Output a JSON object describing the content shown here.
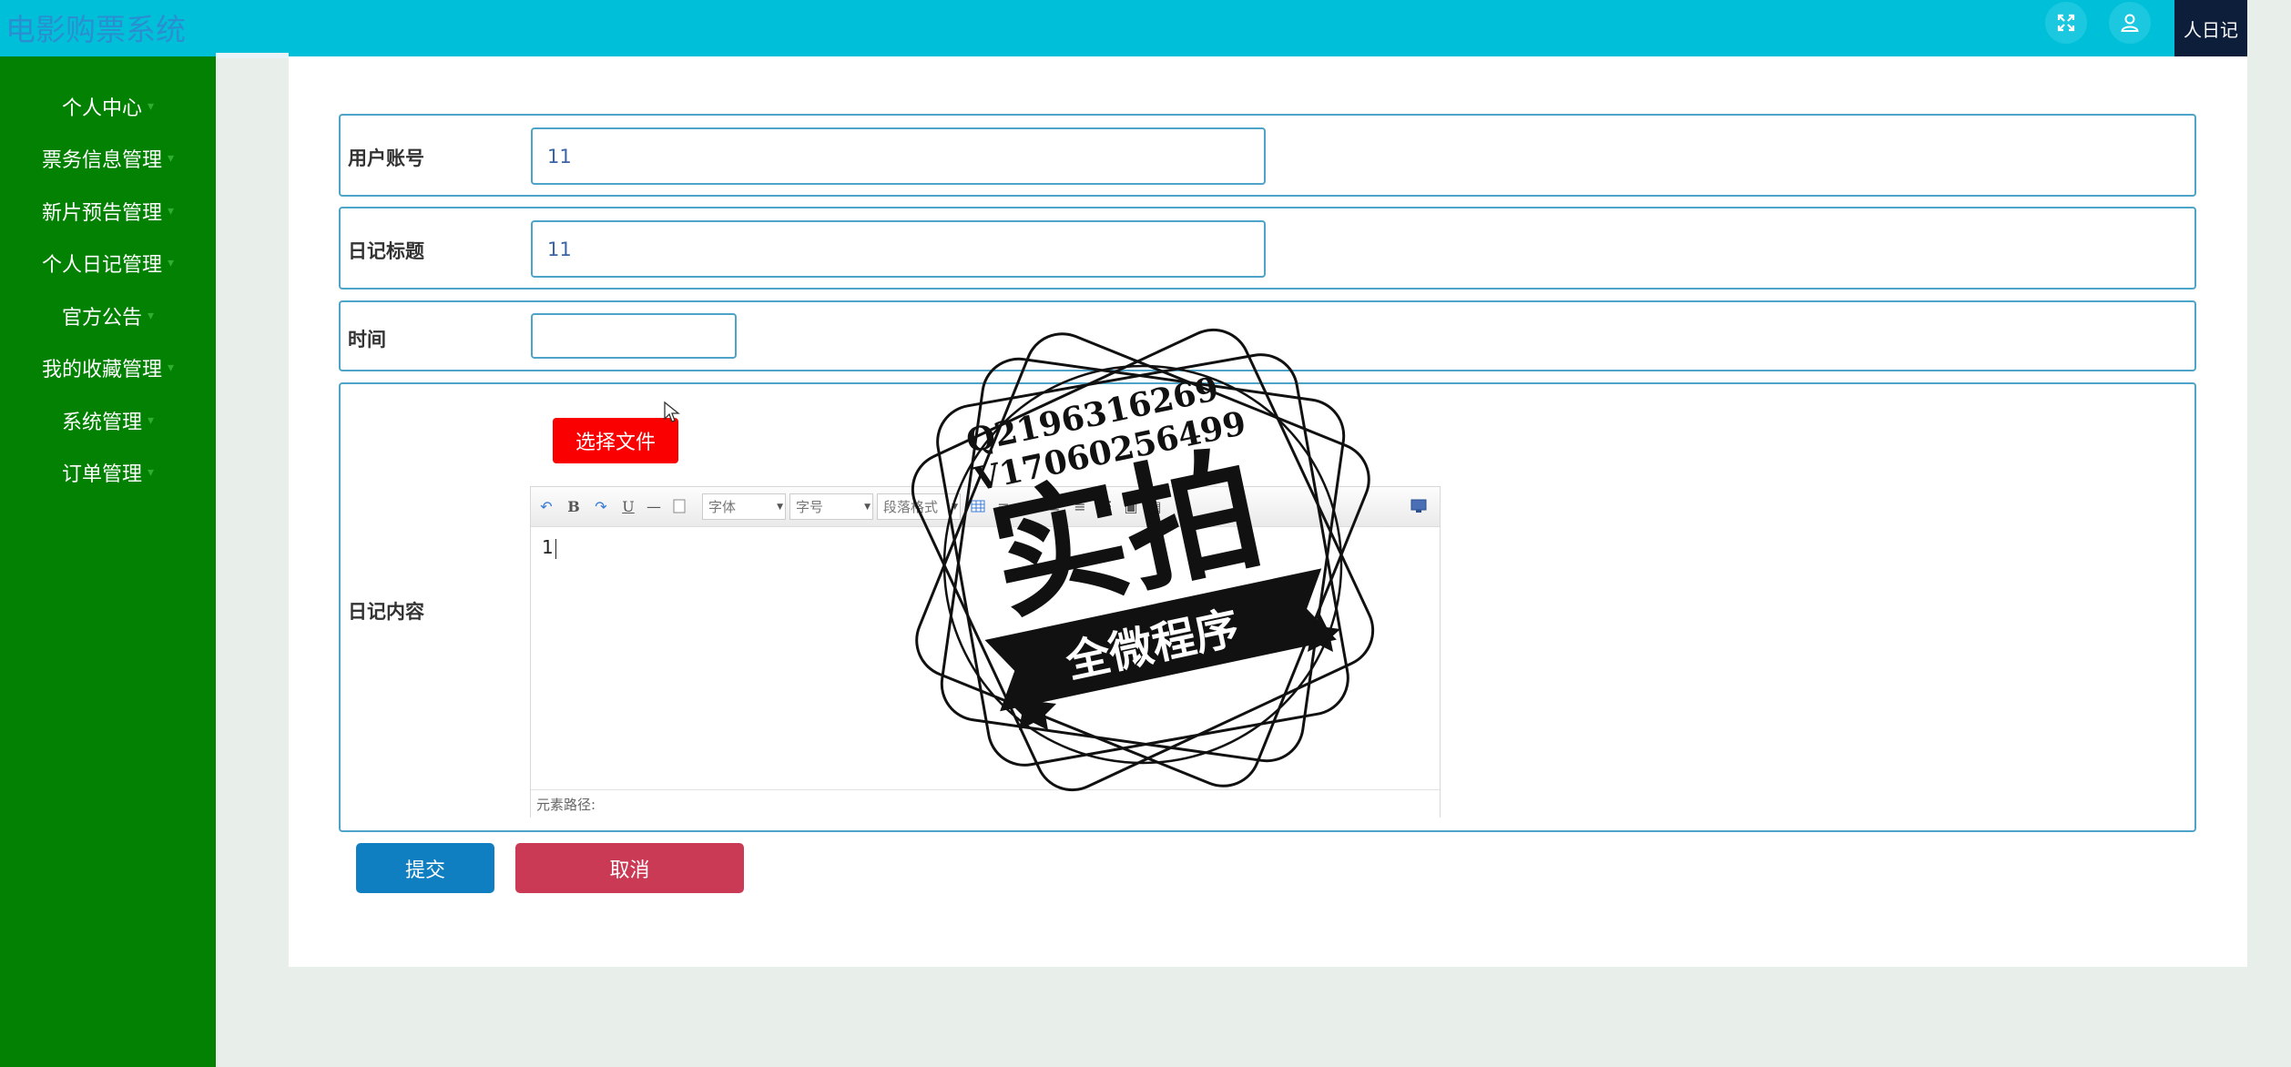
{
  "app": {
    "title": "电影购票系统"
  },
  "header": {
    "icons": [
      "fullscreen-icon",
      "user-icon"
    ],
    "active_tab_label": "人日记"
  },
  "sidebar": {
    "items": [
      {
        "label": "个人中心"
      },
      {
        "label": "票务信息管理"
      },
      {
        "label": "新片预告管理"
      },
      {
        "label": "个人日记管理"
      },
      {
        "label": "官方公告"
      },
      {
        "label": "我的收藏管理"
      },
      {
        "label": "系统管理"
      },
      {
        "label": "订单管理"
      }
    ]
  },
  "form": {
    "account": {
      "label": "用户账号",
      "value": "11"
    },
    "title": {
      "label": "日记标题",
      "value": "11"
    },
    "time": {
      "label": "时间",
      "value": ""
    },
    "content": {
      "label": "日记内容",
      "file_button": "选择文件",
      "toolbar": {
        "font_family": "字体",
        "font_size": "字号",
        "paragraph": "段落格式"
      },
      "body": "1",
      "status": "元素路径:"
    },
    "submit_label": "提交",
    "cancel_label": "取消"
  },
  "watermark": {
    "contact_q": "Q2196316269",
    "contact_v": "V17060256499",
    "main": "实拍",
    "banner": "全微程序"
  },
  "colors": {
    "topbar": "#00c0d9",
    "sidebar": "#028102",
    "submit": "#0f7fc1",
    "cancel": "#cb3a55",
    "file_button": "#fa0000"
  }
}
